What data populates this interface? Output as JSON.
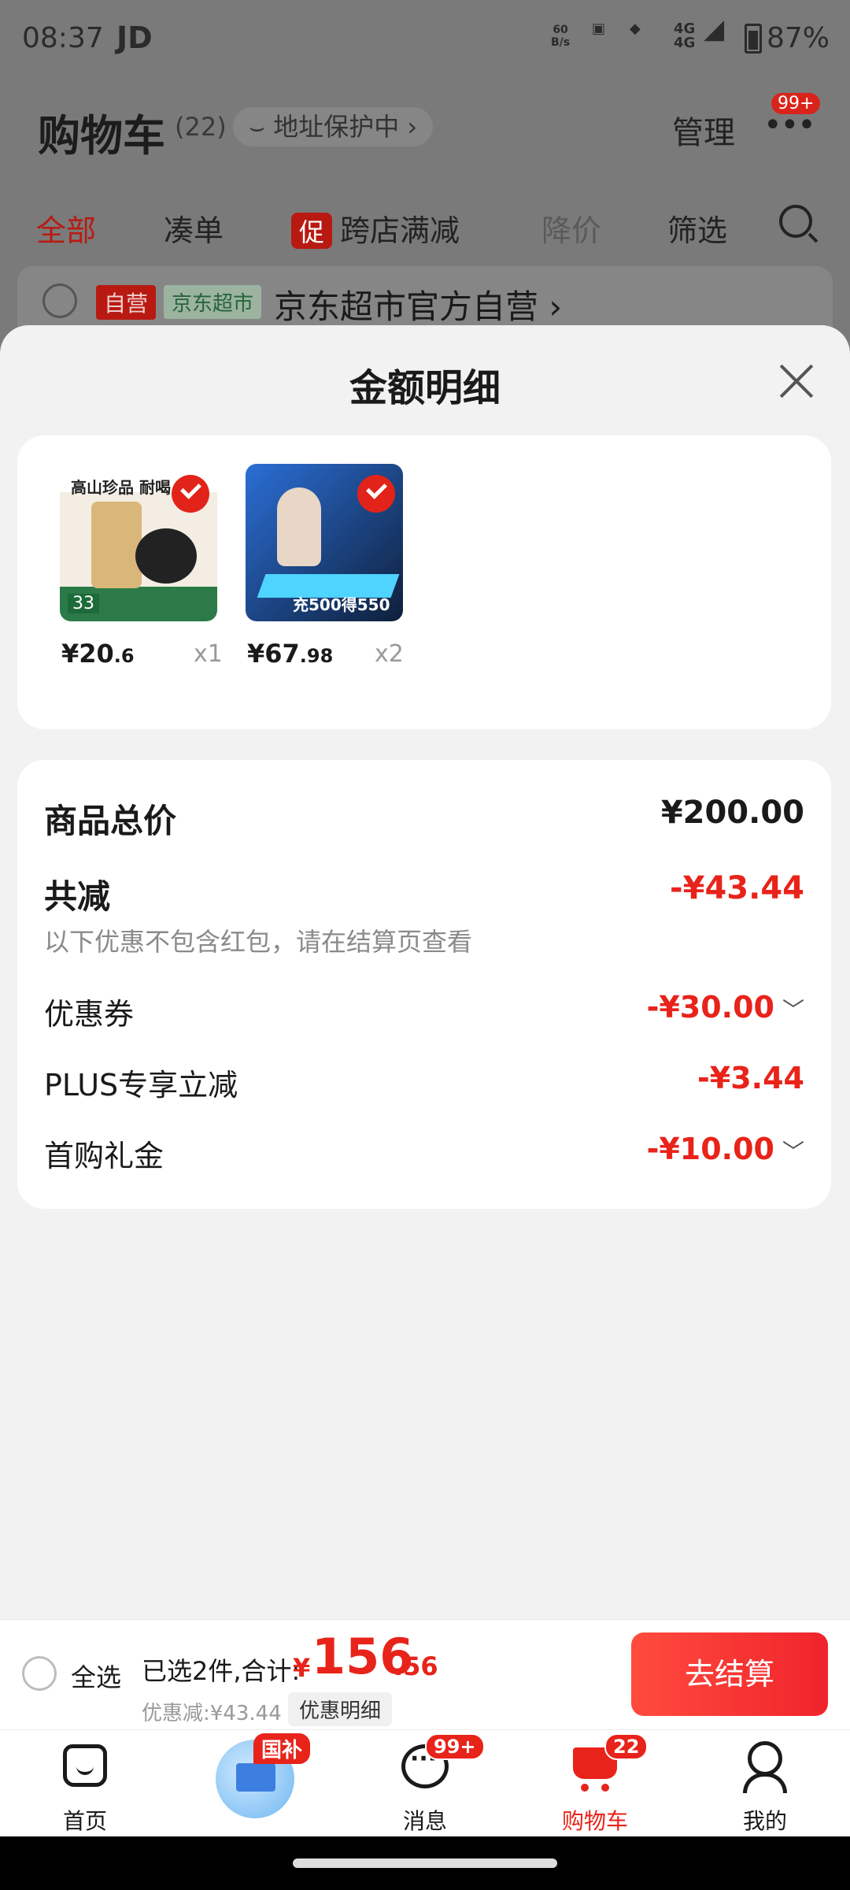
{
  "status_bar": {
    "time": "08:37",
    "carrier": "JD",
    "net_speed_value": "60",
    "net_speed_unit": "B/s",
    "signal": "4G",
    "battery": "87%"
  },
  "cart_header": {
    "title": "购物车",
    "count": "(22)",
    "address_protection": "地址保护中 ›",
    "manage": "管理",
    "more_badge": "99+"
  },
  "cart_tabs": {
    "all": "全部",
    "combine": "凑单",
    "promo_tag": "促",
    "cross_store": "跨店满减",
    "price_drop": "降价",
    "filter": "筛选"
  },
  "store": {
    "self_tag": "自营",
    "super_tag": "京东超市",
    "name": "京东超市官方自营 ›"
  },
  "sheet": {
    "title": "金额明细",
    "products": [
      {
        "image_slogan": "高山珍品 耐喝",
        "image_price": "33",
        "price_int": "¥20",
        "price_dec": ".6",
        "qty": "x1"
      },
      {
        "image_price": "充500得550",
        "price_int": "¥67",
        "price_dec": ".98",
        "qty": "x2"
      }
    ],
    "breakdown": {
      "total_label": "商品总价",
      "total_value": "¥200.00",
      "reduce_label": "共减",
      "reduce_value": "-¥43.44",
      "note": "以下优惠不包含红包，请在结算页查看",
      "items": [
        {
          "label": "优惠券",
          "value": "-¥30.00",
          "chevron": "﹀"
        },
        {
          "label": "PLUS专享立减",
          "value": "-¥3.44"
        },
        {
          "label": "首购礼金",
          "value": "-¥10.00",
          "chevron": "﹀"
        }
      ]
    }
  },
  "checkout_bar": {
    "select_all": "全选",
    "summary": "已选2件,合计:",
    "currency": "¥",
    "total_int": "156",
    "total_dec": ".56",
    "discount": "优惠减:¥43.44",
    "discount_detail_button": "优惠明细",
    "pay_button": "去结算"
  },
  "tab_bar": {
    "home": "首页",
    "promo_badge": "国补",
    "messages": "消息",
    "messages_badge": "99+",
    "cart": "购物车",
    "cart_badge": "22",
    "me": "我的"
  },
  "colors": {
    "accent": "#e8231a",
    "pay_button": "#f0242b"
  }
}
